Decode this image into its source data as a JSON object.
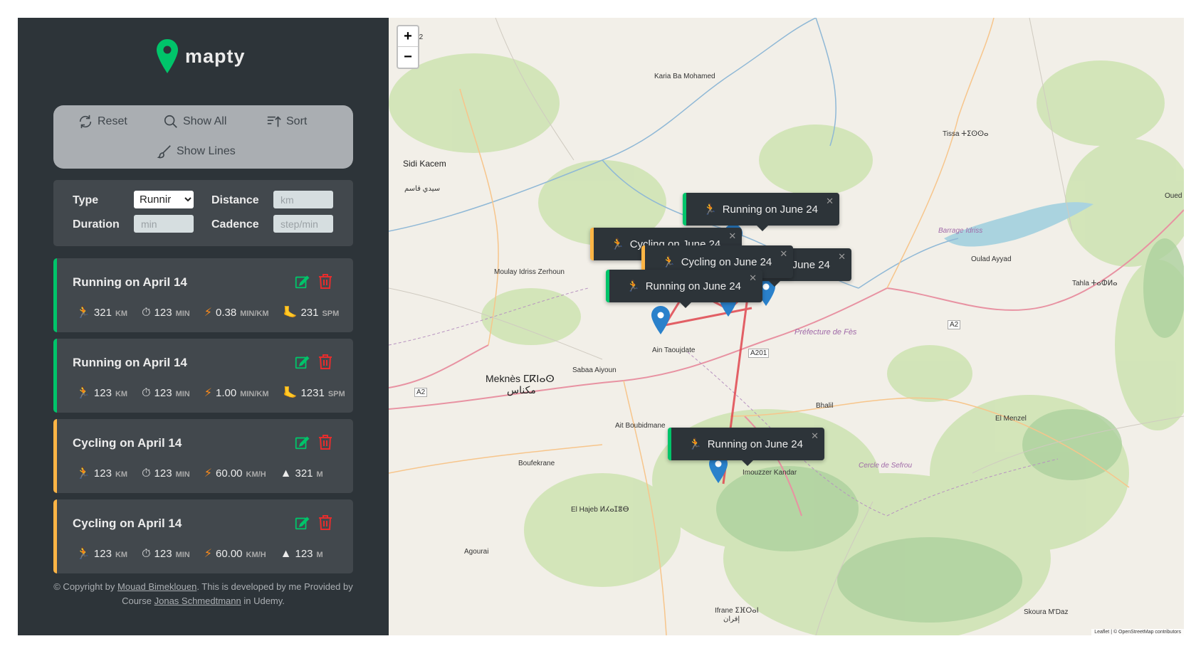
{
  "app": {
    "name": "mapty"
  },
  "controls": {
    "reset": "Reset",
    "show_all": "Show All",
    "sort": "Sort",
    "show_lines": "Show Lines"
  },
  "form": {
    "type_label": "Type",
    "type_value": "Runnir",
    "distance_label": "Distance",
    "distance_placeholder": "km",
    "duration_label": "Duration",
    "duration_placeholder": "min",
    "cadence_label": "Cadence",
    "cadence_placeholder": "step/min"
  },
  "workouts": [
    {
      "type": "running",
      "title": "Running on April 14",
      "distance": "321",
      "distance_unit": "KM",
      "duration": "123",
      "duration_unit": "MIN",
      "pace": "0.38",
      "pace_unit": "MIN/KM",
      "extra": "231",
      "extra_unit": "SPM"
    },
    {
      "type": "running",
      "title": "Running on April 14",
      "distance": "123",
      "distance_unit": "KM",
      "duration": "123",
      "duration_unit": "MIN",
      "pace": "1.00",
      "pace_unit": "MIN/KM",
      "extra": "1231",
      "extra_unit": "SPM"
    },
    {
      "type": "cycling",
      "title": "Cycling on April 14",
      "distance": "123",
      "distance_unit": "KM",
      "duration": "123",
      "duration_unit": "MIN",
      "pace": "60.00",
      "pace_unit": "KM/H",
      "extra": "321",
      "extra_unit": "M"
    },
    {
      "type": "cycling",
      "title": "Cycling on April 14",
      "distance": "123",
      "distance_unit": "KM",
      "duration": "123",
      "duration_unit": "MIN",
      "pace": "60.00",
      "pace_unit": "KM/H",
      "extra": "123",
      "extra_unit": "M"
    }
  ],
  "footer": {
    "prefix": "© Copyright by ",
    "author": "Mouad Bimeklouen",
    "middle": ". This is developed by me Provided by Course ",
    "course_author": "Jonas Schmedtmann",
    "suffix": " in Udemy."
  },
  "map": {
    "zoom_in": "+",
    "zoom_out": "−",
    "popups": [
      {
        "type": "running",
        "label": "Running on June 24"
      },
      {
        "type": "cycling",
        "label": "Cycling on June 24"
      },
      {
        "type": "running",
        "label": "Running on June 24"
      },
      {
        "type": "cycling",
        "label": "Cycling on June 24"
      },
      {
        "type": "running",
        "label": "Running on June 24"
      },
      {
        "type": "running",
        "label": "Running on June 24"
      }
    ],
    "labels": {
      "meknes": "Meknès ⵎⴽⵏⴰⵙ",
      "meknes_ar": "مكناس",
      "sidi_kacem": "Sidi Kacem",
      "sidi_kacem_ar": "سيدي قاسم",
      "fes_prov": "Préfecture de Fès",
      "sefrou": "Cercle de Sefrou",
      "ifrane": "Ifrane ⵉⴼⵔⴰⵏ",
      "ifrane_ar": "إفران",
      "imouzzer": "Imouzzer Kandar",
      "el_hajeb": "El Hajeb ⵍⵃⴰⵊⴻⴱ",
      "agourai": "Agourai",
      "boufekrane": "Boufekrane",
      "ait_boubidmane": "Ait Boubidmane",
      "sabaa_aiyoun": "Sabaa Aiyoun",
      "ain_taoujdate": "Ain Taoujdate",
      "moulay_idriss": "Moulay Idriss Zerhoun",
      "karia": "Karia Ba Mohamed",
      "tissa": "Tissa ⵜⵉⵙⵙⴰ",
      "oulad_ayyad": "Oulad Ayyad",
      "tahla": "Tahla ⵜⴰⵀⵍⴰ",
      "el_menzel": "El Menzel",
      "bhalil": "Bhalil",
      "skoura": "Skoura M'Daz",
      "barrage": "Barrage Idriss",
      "a2": "A2",
      "a201": "A201",
      "ouled": "Oued"
    },
    "attribution": "Leaflet | © OpenStreetMap contributors"
  },
  "colors": {
    "running": "#00c46a",
    "cycling": "#ffb545",
    "sidebar": "#2d3439",
    "card": "#42484d",
    "route": "#e0464f",
    "marker": "#2a81cb"
  }
}
